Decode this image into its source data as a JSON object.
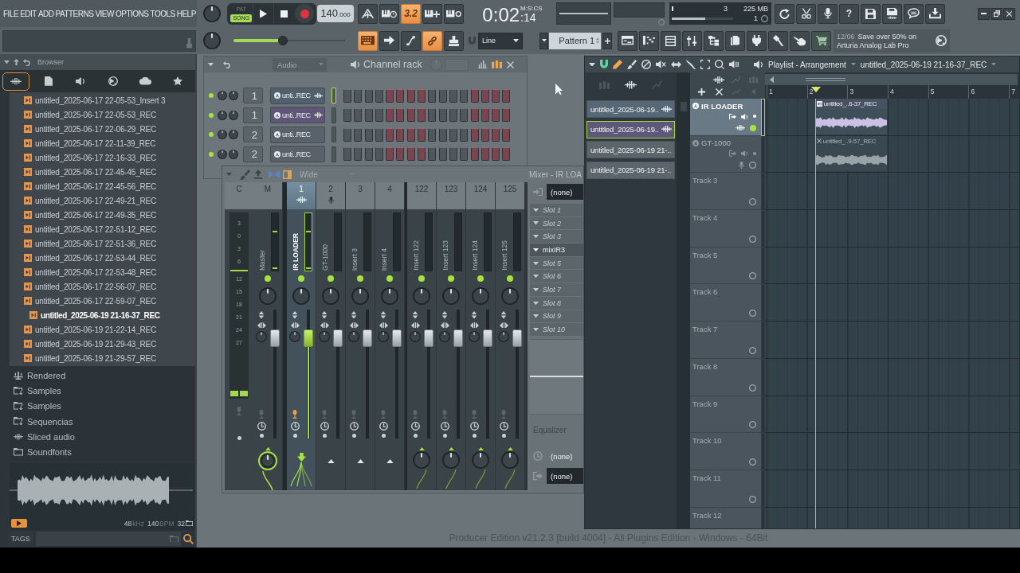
{
  "menu": [
    "FILE",
    "EDIT",
    "ADD",
    "PATTERNS",
    "VIEW",
    "OPTIONS",
    "TOOLS",
    "HELP"
  ],
  "transport": {
    "modes": [
      {
        "label": "PAT",
        "selected": false
      },
      {
        "label": "SONG",
        "selected": true
      }
    ],
    "tempo_whole": "140",
    "tempo_fraction": ".000"
  },
  "record_buttons": [
    {
      "on": false
    },
    {
      "on": false
    },
    {
      "label": "3.2",
      "on": true
    },
    {
      "on": false
    },
    {
      "on": false
    }
  ],
  "time": {
    "main": "0:02",
    "small": ":14",
    "unit": "M:S:CS"
  },
  "cpu": {
    "value_1": "3",
    "memory": "225 MB",
    "value_2": "1",
    "level": 0.55
  },
  "help_label": "?",
  "song_position": {
    "level": 0.44
  },
  "tool_buttons": [
    {
      "on": true
    },
    {
      "on": false
    },
    {
      "on": false
    },
    {
      "on": true
    },
    {
      "on": false
    }
  ],
  "snap": {
    "value": "Line"
  },
  "pattern": {
    "value": "Pattern 1"
  },
  "news": {
    "date": "12/06",
    "line_1": "Save over 50% on",
    "line_2": "Arturia Analog Lab Pro"
  },
  "browser": {
    "title": "Browser",
    "tabs": [
      {
        "selected": true
      },
      {
        "selected": false
      },
      {
        "selected": false
      },
      {
        "selected": false
      },
      {
        "selected": false
      },
      {
        "selected": false
      }
    ],
    "files": [
      {
        "name": "untitled_2025-06-17 22-05-53_Insert 3",
        "selected": false
      },
      {
        "name": "untitled_2025-06-17 22-05-53_REC",
        "selected": false
      },
      {
        "name": "untitled_2025-06-17 22-06-29_REC",
        "selected": false
      },
      {
        "name": "untitled_2025-06-17 22-11-39_REC",
        "selected": false
      },
      {
        "name": "untitled_2025-06-17 22-16-33_REC",
        "selected": false
      },
      {
        "name": "untitled_2025-06-17 22-45-45_REC",
        "selected": false
      },
      {
        "name": "untitled_2025-06-17 22-45-56_REC",
        "selected": false
      },
      {
        "name": "untitled_2025-06-17 22-49-21_REC",
        "selected": false
      },
      {
        "name": "untitled_2025-06-17 22-49-35_REC",
        "selected": false
      },
      {
        "name": "untitled_2025-06-17 22-51-12_REC",
        "selected": false
      },
      {
        "name": "untitled_2025-06-17 22-51-36_REC",
        "selected": false
      },
      {
        "name": "untitled_2025-06-17 22-53-44_REC",
        "selected": false
      },
      {
        "name": "untitled_2025-06-17 22-53-48_REC",
        "selected": false
      },
      {
        "name": "untitled_2025-06-17 22-56-07_REC",
        "selected": false
      },
      {
        "name": "untitled_2025-06-17 22-59-07_REC",
        "selected": false
      },
      {
        "name": "untitled_2025-06-19 21-16-37_REC",
        "selected": true
      },
      {
        "name": "untitled_2025-06-19 21-22-14_REC",
        "selected": false
      },
      {
        "name": "untitled_2025-06-19 21-29-43_REC",
        "selected": false
      },
      {
        "name": "untitled_2025-06-19 21-29-57_REC",
        "selected": false
      }
    ],
    "folders": [
      {
        "name": "Rendered",
        "kind": "rendered"
      },
      {
        "name": "Samples",
        "kind": "linked"
      },
      {
        "name": "Samples",
        "kind": "linked"
      },
      {
        "name": "Sequencias",
        "kind": "linked"
      },
      {
        "name": "Sliced audio",
        "kind": "sliced"
      },
      {
        "name": "Soundfonts",
        "kind": "folder"
      }
    ],
    "preview": {
      "rate": "48",
      "rate_unit": "kHz",
      "tempo": "140",
      "tempo_unit": "BPM",
      "bits": "32"
    },
    "tags_label": "TAGS"
  },
  "channel_rack": {
    "filter": "Audio",
    "title": "Channel rack",
    "channels": [
      {
        "enabled": true,
        "route": "1",
        "name": "unti..REC",
        "color": "#50616d",
        "wave_icon": true,
        "selected": true
      },
      {
        "enabled": true,
        "route": "1",
        "name": "unti..REC",
        "color": "#5e5577",
        "wave_icon": true,
        "selected": false
      },
      {
        "enabled": true,
        "route": "2",
        "name": "unti..REC",
        "color": "#59626a",
        "wave_icon": false,
        "selected": false
      },
      {
        "enabled": true,
        "route": "2",
        "name": "unti..REC",
        "color": "#59626a",
        "wave_icon": false,
        "selected": false
      }
    ]
  },
  "mixer": {
    "preset": "Wide",
    "title": "Mixer - IR LOA",
    "meter_header": "C",
    "scale": [
      "3",
      "0",
      "3",
      "6",
      "12",
      "15",
      "18",
      "21",
      "24",
      "27"
    ],
    "strips": [
      {
        "number": "M",
        "name": "Master",
        "selected": false,
        "enabled": true,
        "peak": true,
        "armed": false,
        "level": 0.82,
        "send": {
          "kind": "ring_knob"
        }
      },
      {
        "number": "1",
        "name": "IR LOADER",
        "selected": true,
        "enabled": true,
        "peak": true,
        "armed": true,
        "level": 0.82,
        "send": {
          "kind": "down_arrow"
        },
        "input": {
          "kind": "wave"
        }
      },
      {
        "number": "2",
        "name": "GT-1000",
        "selected": false,
        "enabled": true,
        "peak": false,
        "armed": false,
        "level": 0.82,
        "send": {
          "kind": "up_arrow"
        },
        "input": {
          "kind": "mic"
        }
      },
      {
        "number": "3",
        "name": "Insert 3",
        "selected": false,
        "enabled": true,
        "peak": false,
        "armed": false,
        "level": 0.82,
        "send": {
          "kind": "up_arrow"
        }
      },
      {
        "number": "4",
        "name": "Insert 4",
        "selected": false,
        "enabled": true,
        "peak": false,
        "armed": false,
        "level": 0.82,
        "send": {
          "kind": "up_arrow"
        }
      },
      {
        "number": "122",
        "name": "Insert 122",
        "selected": false,
        "enabled": true,
        "peak": false,
        "armed": false,
        "level": 0.82,
        "send": {
          "kind": "knob"
        }
      },
      {
        "number": "123",
        "name": "Insert 123",
        "selected": false,
        "enabled": true,
        "peak": false,
        "armed": false,
        "level": 0.82,
        "send": {
          "kind": "knob"
        }
      },
      {
        "number": "124",
        "name": "Insert 124",
        "selected": false,
        "enabled": true,
        "peak": false,
        "armed": false,
        "level": 0.82,
        "send": {
          "kind": "knob"
        }
      },
      {
        "number": "125",
        "name": "Insert 125",
        "selected": false,
        "enabled": true,
        "peak": false,
        "armed": false,
        "level": 0.82,
        "send": {
          "kind": "knob"
        }
      }
    ],
    "insert": {
      "input": "(none)",
      "slots": [
        {
          "name": "Slot 1",
          "loaded": false
        },
        {
          "name": "Slot 2",
          "loaded": false
        },
        {
          "name": "Slot 3",
          "loaded": false
        },
        {
          "name": "mixIR3",
          "loaded": true
        },
        {
          "name": "Slot 5",
          "loaded": false
        },
        {
          "name": "Slot 6",
          "loaded": false
        },
        {
          "name": "Slot 7",
          "loaded": false
        },
        {
          "name": "Slot 8",
          "loaded": false
        },
        {
          "name": "Slot 9",
          "loaded": false
        },
        {
          "name": "Slot 10",
          "loaded": false
        }
      ],
      "eq_label": "Equalizer",
      "output_1": "(none)",
      "output_2": "(none)"
    }
  },
  "playlist": {
    "title": "Playlist - Arrangement",
    "arrangement": "untitled_2025-06-19 21-16-37_REC",
    "picker": [
      {
        "name": "untitled_2025-06-19..",
        "color": "#566876",
        "wave_icon": true,
        "selected": false
      },
      {
        "name": "untitled_2025-06-19..",
        "color": "#5e5878",
        "wave_icon": true,
        "selected": true
      },
      {
        "name": "untitled_2025-06-19 21-..",
        "color": "#5c656b",
        "wave_icon": false,
        "selected": false
      },
      {
        "name": "untitled_2025-06-19 21-..",
        "color": "#5c656b",
        "wave_icon": false,
        "selected": false
      }
    ],
    "bars": [
      "1",
      "2",
      "3",
      "4",
      "5",
      "6",
      "7"
    ],
    "tracks": [
      {
        "name": "IR LOADER",
        "kind": "routed",
        "selected": true,
        "input": {
          "kind": "wave"
        },
        "clips": [
          {
            "name": "untitled_..6-37_REC",
            "muted": false
          }
        ]
      },
      {
        "name": "GT-1000",
        "kind": "routed",
        "selected": false,
        "input": {
          "kind": "mic"
        },
        "clips": [
          {
            "name": "untitled_..9-57_REC",
            "muted": true
          }
        ]
      },
      {
        "name": "Track 3",
        "kind": "plain",
        "selected": false
      },
      {
        "name": "Track 4",
        "kind": "plain",
        "selected": false
      },
      {
        "name": "Track 5",
        "kind": "plain",
        "selected": false
      },
      {
        "name": "Track 6",
        "kind": "plain",
        "selected": false
      },
      {
        "name": "Track 7",
        "kind": "plain",
        "selected": false
      },
      {
        "name": "Track 8",
        "kind": "plain",
        "selected": false
      },
      {
        "name": "Track 9",
        "kind": "plain",
        "selected": false
      },
      {
        "name": "Track 10",
        "kind": "plain",
        "selected": false
      },
      {
        "name": "Track 11",
        "kind": "plain",
        "selected": false
      },
      {
        "name": "Track 12",
        "kind": "plain",
        "selected": false
      }
    ]
  },
  "status_text": "Producer Edition v21.2.3 [build 4004] - All Plugins Edition - Windows - 64Bit"
}
